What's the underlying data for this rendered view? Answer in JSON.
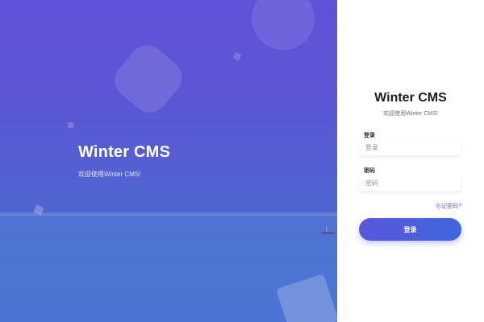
{
  "hero": {
    "title": "Winter CMS",
    "subtitle": "欢迎使用Winter CMS!"
  },
  "login": {
    "title": "Winter CMS",
    "subtitle": "欢迎使用Winter CMS!",
    "username_label": "登录",
    "username_placeholder": "登录",
    "password_label": "密码",
    "password_placeholder": "密码",
    "forgot_link": "忘记密码?",
    "submit_label": "登录"
  },
  "colors": {
    "hero_gradient_top": "#6152d8",
    "hero_gradient_bottom": "#4f74d3",
    "button_start": "#5a56de",
    "button_end": "#3f66db",
    "link": "#6c64d6"
  }
}
